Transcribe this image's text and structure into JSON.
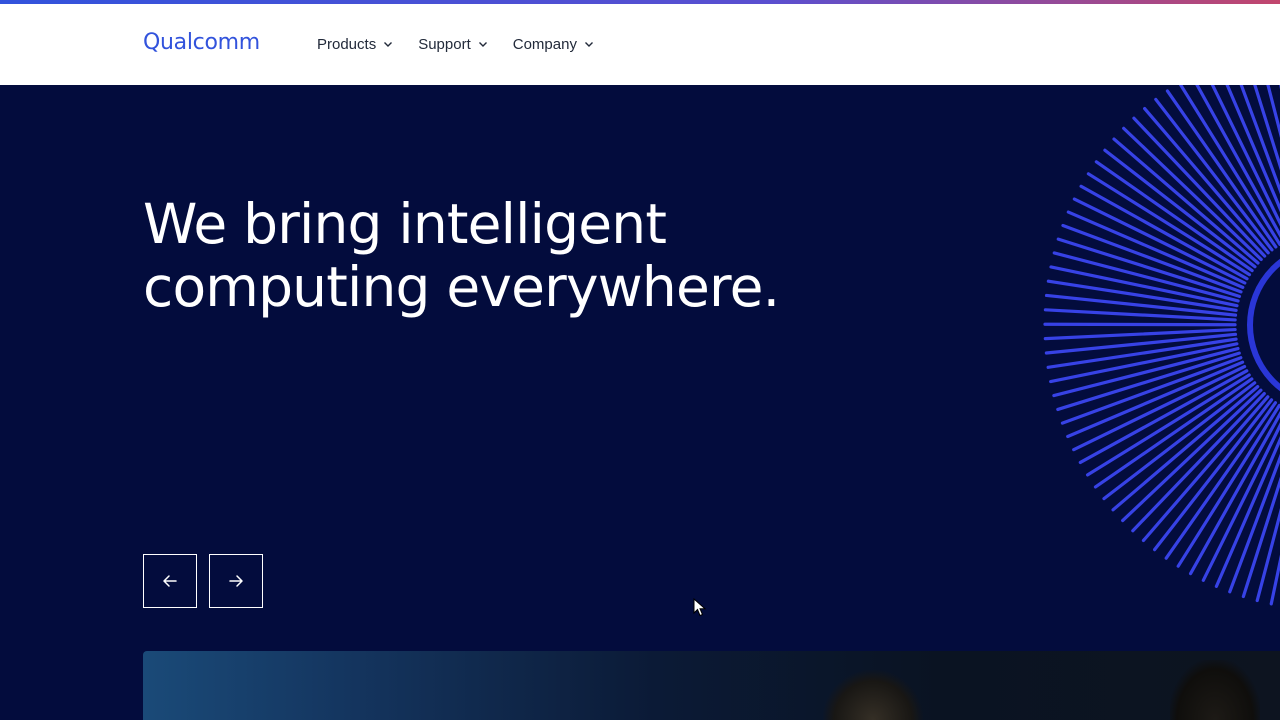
{
  "brand": {
    "logo_text": "Qualcomm",
    "accent_color": "#3253dc",
    "hero_background": "#030c3d"
  },
  "nav": {
    "items": [
      {
        "label": "Products",
        "icon": "chevron-down-icon"
      },
      {
        "label": "Support",
        "icon": "chevron-down-icon"
      },
      {
        "label": "Company",
        "icon": "chevron-down-icon"
      }
    ]
  },
  "hero": {
    "headline_line1": "We bring intelligent",
    "headline_line2": "computing everywhere.",
    "decoration_icon": "sunburst-graphic"
  },
  "carousel": {
    "prev_icon": "arrow-left-icon",
    "next_icon": "arrow-right-icon"
  }
}
